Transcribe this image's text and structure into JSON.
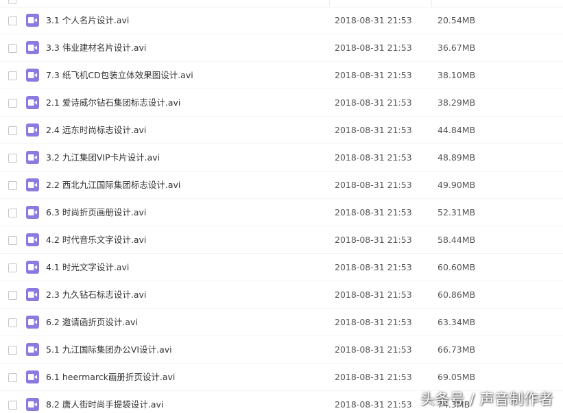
{
  "colors": {
    "file_icon": "#8d7ae0",
    "row_text": "#333333",
    "meta_text": "#555555"
  },
  "icons": {
    "file_type": "video-file-icon"
  },
  "files": [
    {
      "name": "3.1  个人名片设计.avi",
      "date": "2018-08-31 21:53",
      "size": "20.54MB"
    },
    {
      "name": "3.3  伟业建材名片设计.avi",
      "date": "2018-08-31 21:53",
      "size": "36.67MB"
    },
    {
      "name": "7.3  纸飞机CD包装立体效果图设计.avi",
      "date": "2018-08-31 21:53",
      "size": "38.10MB"
    },
    {
      "name": "2.1  爱诗威尔钻石集团标志设计.avi",
      "date": "2018-08-31 21:53",
      "size": "38.29MB"
    },
    {
      "name": "2.4  远东时尚标志设计.avi",
      "date": "2018-08-31 21:53",
      "size": "44.84MB"
    },
    {
      "name": "3.2  九江集团VIP卡片设计.avi",
      "date": "2018-08-31 21:53",
      "size": "48.89MB"
    },
    {
      "name": "2.2  西北九江国际集团标志设计.avi",
      "date": "2018-08-31 21:53",
      "size": "49.90MB"
    },
    {
      "name": "6.3  时尚折页画册设计.avi",
      "date": "2018-08-31 21:53",
      "size": "52.31MB"
    },
    {
      "name": "4.2  时代音乐文字设计.avi",
      "date": "2018-08-31 21:53",
      "size": "58.44MB"
    },
    {
      "name": "4.1  时光文字设计.avi",
      "date": "2018-08-31 21:53",
      "size": "60.60MB"
    },
    {
      "name": "2.3  九久钻石标志设计.avi",
      "date": "2018-08-31 21:53",
      "size": "60.86MB"
    },
    {
      "name": "6.2  邀请函折页设计.avi",
      "date": "2018-08-31 21:53",
      "size": "63.34MB"
    },
    {
      "name": "5.1  九江国际集团办公VI设计.avi",
      "date": "2018-08-31 21:53",
      "size": "66.73MB"
    },
    {
      "name": "6.1  heermarck画册折页设计.avi",
      "date": "2018-08-31 21:53",
      "size": "69.05MB"
    },
    {
      "name": "8.2  唐人街时尚手提袋设计.avi",
      "date": "2018-08-31 21:53",
      "size": "74.3MB"
    }
  ],
  "watermark": "头条号 / 声音制作者"
}
